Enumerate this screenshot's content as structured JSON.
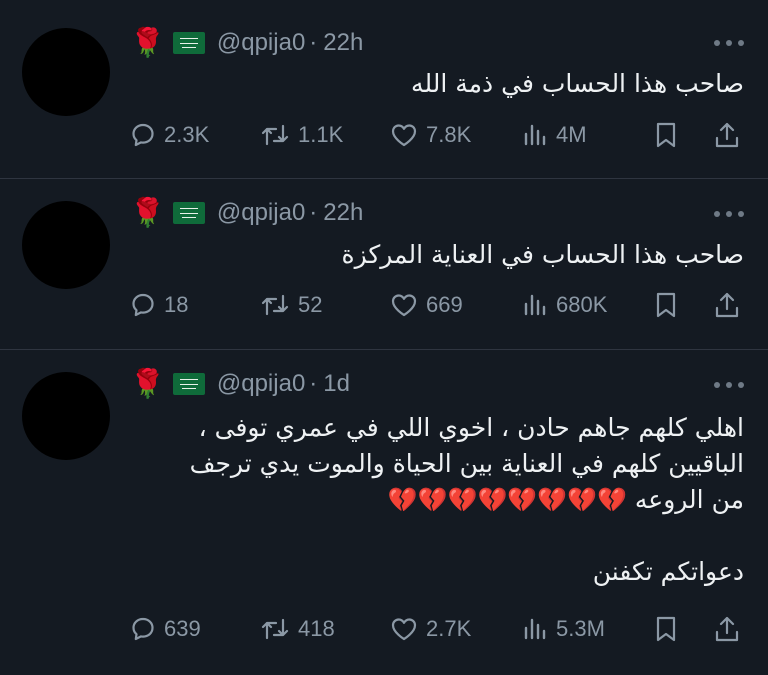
{
  "tweets": [
    {
      "handle": "@qpija0",
      "dot": "·",
      "time": "22h",
      "rose": "🌹",
      "lines": [
        "صاحب هذا الحساب في ذمة الله"
      ],
      "extra": "",
      "hearts": "",
      "replies": "2.3K",
      "retweets": "1.1K",
      "likes": "7.8K",
      "views": "4M"
    },
    {
      "handle": "@qpija0",
      "dot": "·",
      "time": "22h",
      "rose": "🌹",
      "lines": [
        "صاحب هذا الحساب في العناية المركزة"
      ],
      "extra": "",
      "hearts": "",
      "replies": "18",
      "retweets": "52",
      "likes": "669",
      "views": "680K"
    },
    {
      "handle": "@qpija0",
      "dot": "·",
      "time": "1d",
      "rose": "🌹",
      "lines": [
        "اهلي كلهم جاهم حادن ، اخوي اللي في عمري توفى ،",
        "الباقيين كلهم في العناية بين الحياة والموت يدي ترجف",
        "من الروعه"
      ],
      "hearts": "💔💔💔💔💔💔💔💔",
      "extra": "دعواتكم تكفنن",
      "replies": "639",
      "retweets": "418",
      "likes": "2.7K",
      "views": "5.3M"
    }
  ]
}
